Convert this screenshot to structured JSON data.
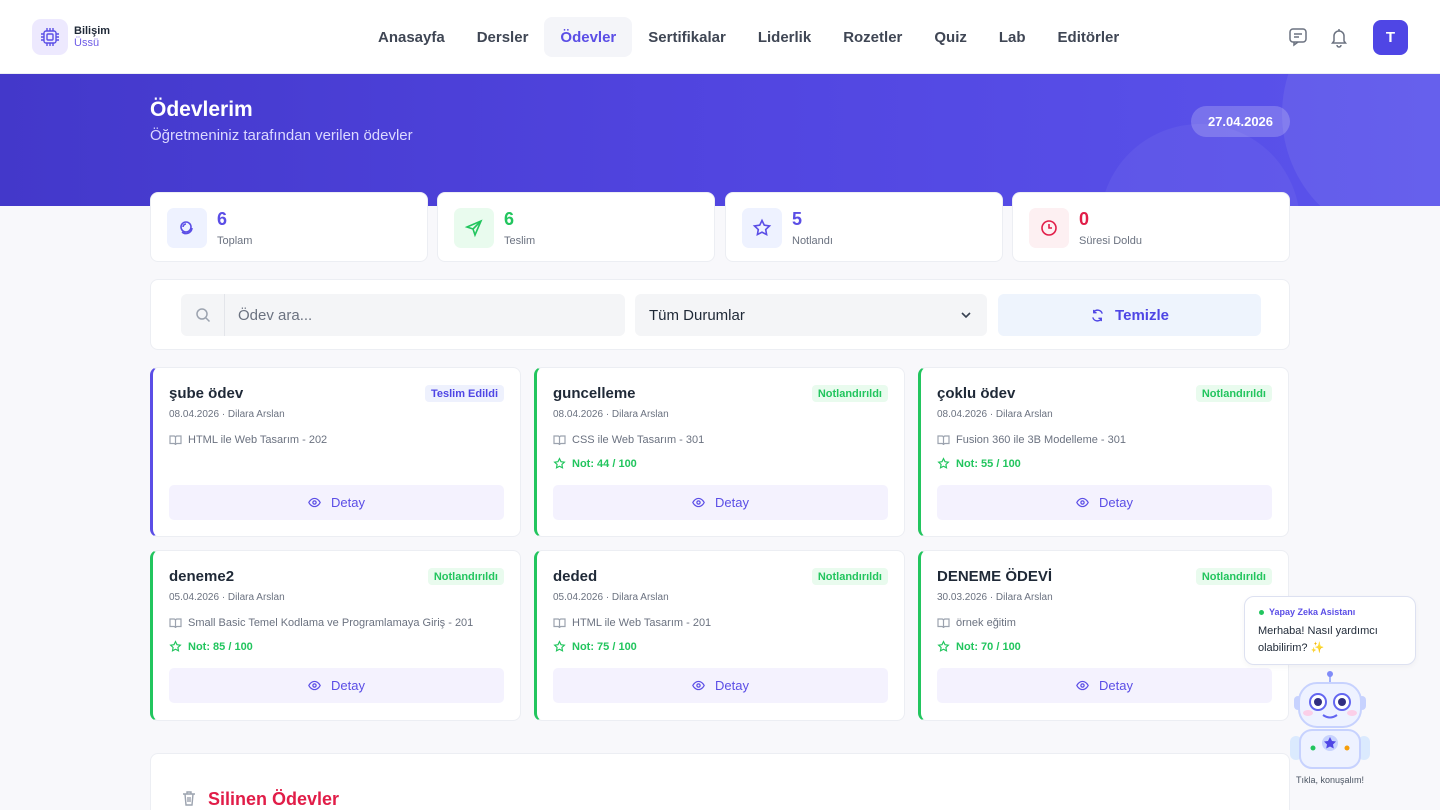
{
  "nav": {
    "brand_line1": "Bilişim",
    "brand_line2": "Üssü",
    "items": [
      {
        "label": "Anasayfa",
        "active": false
      },
      {
        "label": "Dersler",
        "active": false
      },
      {
        "label": "Ödevler",
        "active": true
      },
      {
        "label": "Sertifikalar",
        "active": false
      },
      {
        "label": "Liderlik",
        "active": false
      },
      {
        "label": "Rozetler",
        "active": false
      },
      {
        "label": "Quiz",
        "active": false
      },
      {
        "label": "Lab",
        "active": false
      },
      {
        "label": "Editörler",
        "active": false
      }
    ],
    "avatar_initial": "T"
  },
  "hero": {
    "title": "Ödevlerim",
    "subtitle": "Öğretmeniniz tarafından verilen ödevler",
    "date": "27.04.2026"
  },
  "stats": [
    {
      "value": "6",
      "label": "Toplam",
      "color": "#5b4ee6",
      "icon": "stack-icon"
    },
    {
      "value": "6",
      "label": "Teslim",
      "color": "#22c55e",
      "icon": "send-icon"
    },
    {
      "value": "5",
      "label": "Notlandı",
      "color": "#5b4ee6",
      "icon": "star-icon"
    },
    {
      "value": "0",
      "label": "Süresi Doldu",
      "color": "#e11d48",
      "icon": "clock-icon"
    }
  ],
  "filter": {
    "search_placeholder": "Ödev ara...",
    "status_selected": "Tüm Durumlar",
    "clear_label": "Temizle"
  },
  "assignments": [
    {
      "title": "şube ödev",
      "badge": "Teslim Edildi",
      "status": "submitted",
      "meta": "08.04.2026 · Dilara Arslan",
      "course": "HTML ile Web Tasarım - 202",
      "grade": "",
      "detail": "Detay"
    },
    {
      "title": "guncelleme",
      "badge": "Notlandırıldı",
      "status": "graded",
      "meta": "08.04.2026 · Dilara Arslan",
      "course": "CSS ile Web Tasarım - 301",
      "grade": "Not: 44 / 100",
      "detail": "Detay"
    },
    {
      "title": "çoklu ödev",
      "badge": "Notlandırıldı",
      "status": "graded",
      "meta": "08.04.2026 · Dilara Arslan",
      "course": "Fusion 360 ile 3B Modelleme - 301",
      "grade": "Not: 55 / 100",
      "detail": "Detay"
    },
    {
      "title": "deneme2",
      "badge": "Notlandırıldı",
      "status": "graded",
      "meta": "05.04.2026 · Dilara Arslan",
      "course": "Small Basic Temel Kodlama ve Programlamaya Giriş - 201",
      "grade": "Not: 85 / 100",
      "detail": "Detay"
    },
    {
      "title": "deded",
      "badge": "Notlandırıldı",
      "status": "graded",
      "meta": "05.04.2026 · Dilara Arslan",
      "course": "HTML ile Web Tasarım - 201",
      "grade": "Not: 75 / 100",
      "detail": "Detay"
    },
    {
      "title": "DENEME ÖDEVİ",
      "badge": "Notlandırıldı",
      "status": "graded",
      "meta": "30.03.2026 · Dilara Arslan",
      "course": "örnek eğitim",
      "grade": "Not: 70 / 100",
      "detail": "Detay"
    }
  ],
  "deleted": {
    "title": "Silinen Ödevler"
  },
  "assistant": {
    "name": "Yapay Zeka Asistanı",
    "message": "Merhaba! Nasıl yardımcı olabilirim? ✨",
    "caption": "Tıkla, konuşalım!"
  }
}
